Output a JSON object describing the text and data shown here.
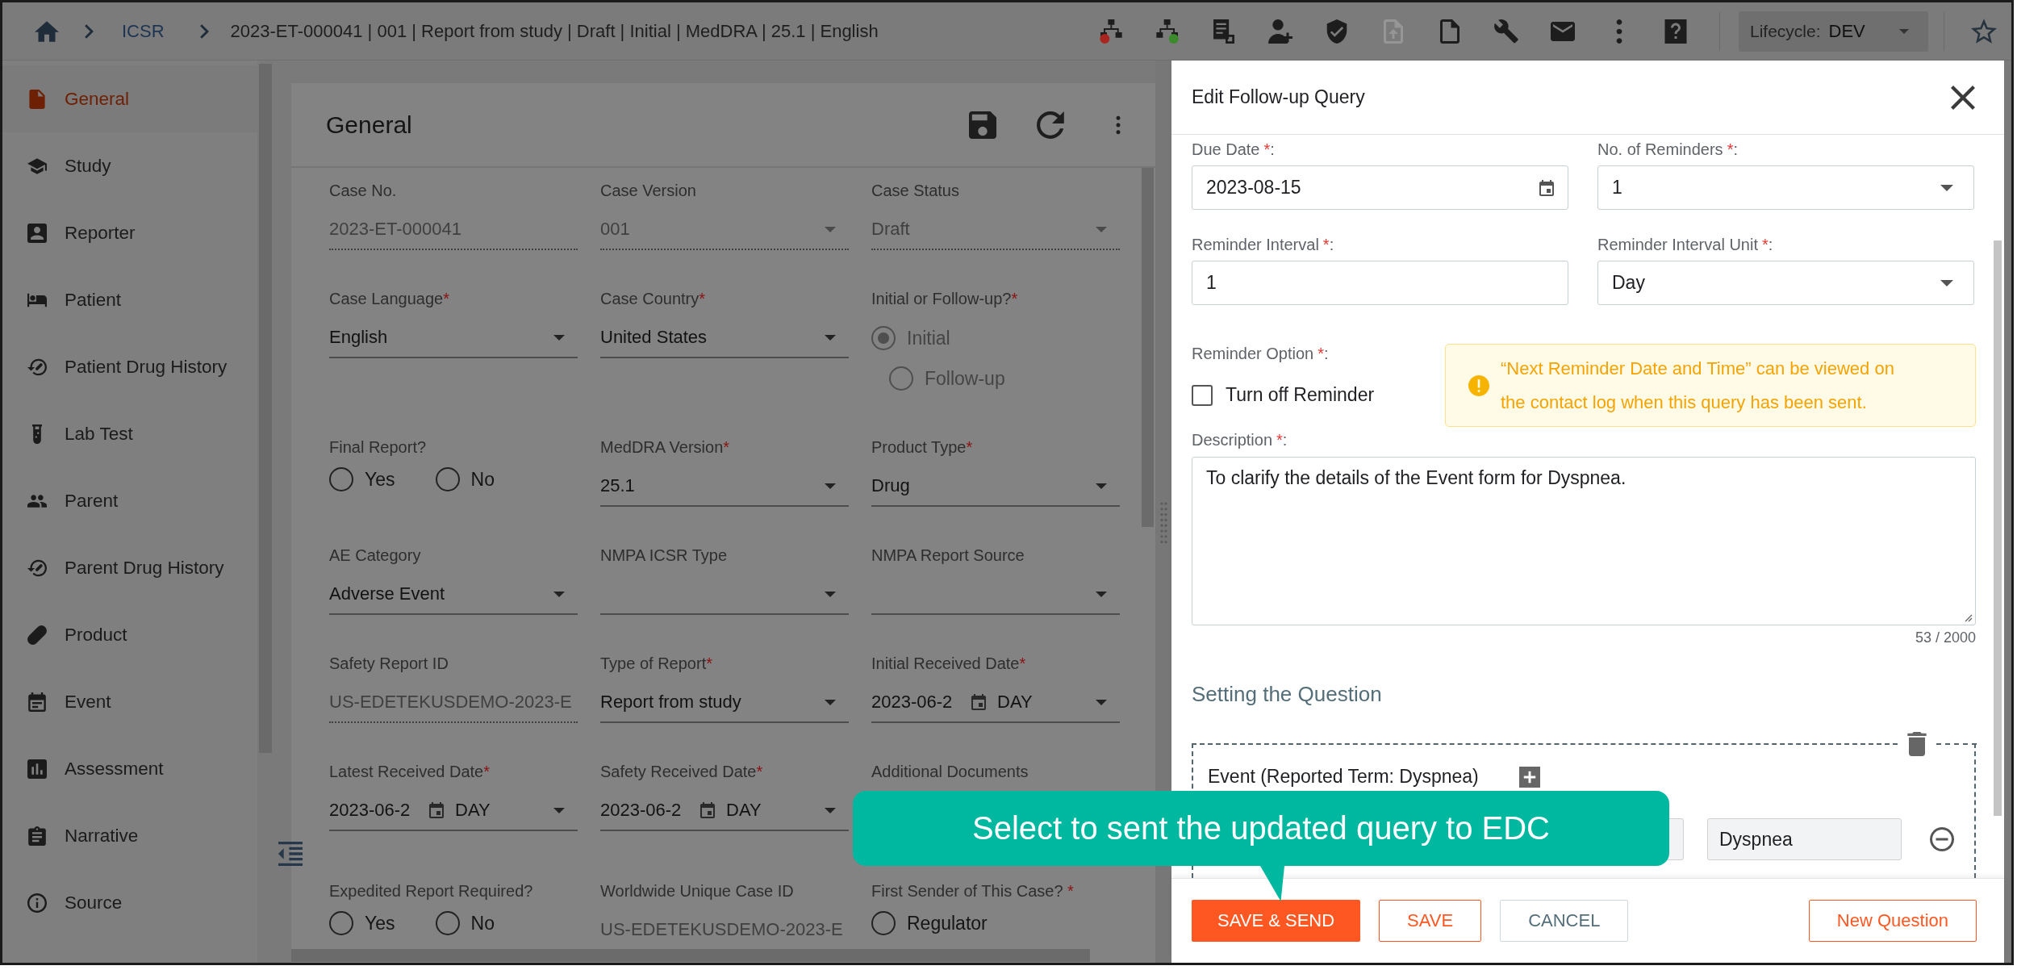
{
  "top_bar": {
    "breadcrumb": {
      "link": "ICSR",
      "current": "2023-ET-000041 | 001 | Report from study | Draft | Initial | MedDRA | 25.1 | English"
    },
    "toolbar": [
      {
        "kind": "unlink",
        "disabled": false
      },
      {
        "kind": "link",
        "disabled": false
      },
      {
        "kind": "report",
        "disabled": false
      },
      {
        "kind": "profile",
        "disabled": false
      },
      {
        "kind": "shield",
        "disabled": false
      },
      {
        "kind": "export",
        "disabled": true
      },
      {
        "kind": "file",
        "disabled": false
      },
      {
        "kind": "wrench",
        "disabled": false
      },
      {
        "kind": "mail",
        "disabled": false
      },
      {
        "kind": "more",
        "disabled": false
      },
      {
        "kind": "help",
        "disabled": false
      }
    ],
    "lifecycle": {
      "label": "Lifecycle:",
      "value": "DEV"
    }
  },
  "sidebar": {
    "items": [
      {
        "label": "General",
        "kind": "document",
        "selected": true
      },
      {
        "label": "Study",
        "kind": "school",
        "selected": false
      },
      {
        "label": "Reporter",
        "kind": "contact",
        "selected": false
      },
      {
        "label": "Patient",
        "kind": "bed",
        "selected": false
      },
      {
        "label": "Patient Drug History",
        "kind": "history",
        "selected": false
      },
      {
        "label": "Lab Test",
        "kind": "flask",
        "selected": false
      },
      {
        "label": "Parent",
        "kind": "people",
        "selected": false
      },
      {
        "label": "Parent Drug History",
        "kind": "history",
        "selected": false
      },
      {
        "label": "Product",
        "kind": "pill",
        "selected": false
      },
      {
        "label": "Event",
        "kind": "calendar",
        "selected": false
      },
      {
        "label": "Assessment",
        "kind": "chart",
        "selected": false
      },
      {
        "label": "Narrative",
        "kind": "clipboard",
        "selected": false
      },
      {
        "label": "Source",
        "kind": "info",
        "selected": false
      }
    ]
  },
  "general": {
    "title": "General",
    "fields": [
      {
        "kind": "text",
        "label": "Case No.",
        "value": "2023-ET-000041",
        "disabled": true
      },
      {
        "kind": "select",
        "label": "Case Version",
        "value": "001",
        "disabled": true
      },
      {
        "kind": "select",
        "label": "Case Status",
        "value": "Draft",
        "disabled": true
      },
      {
        "kind": "select",
        "label": "Case Language",
        "mark": "*",
        "value": "English",
        "disabled": false
      },
      {
        "kind": "select",
        "label": "Case Country",
        "mark": "*",
        "value": "United States",
        "disabled": false
      },
      {
        "kind": "radio_stack",
        "label": "Initial or Follow-up?",
        "mark": "*",
        "disabled": true,
        "options": [
          {
            "label": "Initial",
            "selected": true
          },
          {
            "label": "Follow-up",
            "selected": false
          }
        ]
      },
      {
        "kind": "radio",
        "label": "Final Report?",
        "disabled": false,
        "options": [
          {
            "label": "Yes",
            "selected": false
          },
          {
            "label": "No",
            "selected": false
          }
        ]
      },
      {
        "kind": "select",
        "label": "MedDRA Version",
        "mark": "*",
        "value": "25.1",
        "disabled": false
      },
      {
        "kind": "select",
        "label": "Product Type",
        "mark": "*",
        "value": "Drug",
        "disabled": false
      },
      {
        "kind": "select",
        "label": "AE Category",
        "value": "Adverse Event",
        "disabled": false
      },
      {
        "kind": "select",
        "label": "NMPA ICSR Type",
        "disabled": false
      },
      {
        "kind": "select",
        "label": "NMPA Report Source",
        "disabled": false
      },
      {
        "kind": "text",
        "label": "Safety Report ID",
        "value": "US-EDETEKUSDEMO-2023-E",
        "disabled": true
      },
      {
        "kind": "select",
        "label": "Type of Report",
        "mark": "*",
        "value": "Report from study",
        "disabled": false
      },
      {
        "kind": "date",
        "label": "Initial Received Date",
        "mark": "*",
        "value": "2023-06-2",
        "unit": "DAY",
        "disabled": false
      },
      {
        "kind": "date",
        "label": "Latest Received Date",
        "mark": "*",
        "value": "2023-06-2",
        "unit": "DAY",
        "disabled": false
      },
      {
        "kind": "date",
        "label": "Safety Received Date",
        "mark": "*",
        "value": "2023-06-2",
        "unit": "DAY",
        "disabled": false
      },
      {
        "kind": "documents",
        "label": "Additional Documents"
      },
      {
        "kind": "radio",
        "label": "Expedited Report Required?",
        "disabled": false,
        "options": [
          {
            "label": "Yes",
            "selected": false
          },
          {
            "label": "No",
            "selected": false
          }
        ]
      },
      {
        "kind": "text",
        "label": "Worldwide Unique Case ID",
        "value": "US-EDETEKUSDEMO-2023-E",
        "disabled": true
      },
      {
        "kind": "radio",
        "label": "First Sender of This Case?",
        "mark": " *",
        "disabled": false,
        "options": [
          {
            "label": "Regulator",
            "selected": false
          }
        ]
      }
    ]
  },
  "drawer": {
    "title": "Edit Follow-up Query",
    "fields": [
      {
        "kind": "date",
        "label": "Due Date",
        "mark": "*",
        "end": ":",
        "value": "2023-08-15"
      },
      {
        "kind": "select",
        "label": "No. of Reminders",
        "mark": "*",
        "end": ":",
        "value": "1"
      },
      {
        "kind": "text",
        "label": "Reminder Interval",
        "mark": "*",
        "end": ":",
        "value": "1"
      },
      {
        "kind": "select",
        "label": "Reminder Interval Unit",
        "mark": "*",
        "end": ":",
        "value": "Day"
      }
    ],
    "reminder_option": {
      "label": "Reminder Option",
      "mark": "*",
      "end": ":",
      "checkbox_label": "Turn off Reminder",
      "checked": false
    },
    "notice": "“Next Reminder Date and Time” can be viewed on the contact log when this query has been sent.",
    "description": {
      "label": "Description",
      "mark": "*",
      "end": ":",
      "value": "To clarify the details of the Event form for Dyspnea.",
      "counter": "53 / 2000"
    },
    "section_title": "Setting the Question",
    "question": {
      "label": "Event (Reported Term: Dyspnea)",
      "value": "Dyspnea"
    },
    "buttons": [
      {
        "label": "SAVE & SEND",
        "kind": "primary"
      },
      {
        "label": "SAVE",
        "kind": "outline"
      },
      {
        "label": "CANCEL",
        "kind": "neutral"
      },
      {
        "label": "New Question",
        "kind": "outline"
      }
    ]
  },
  "callout": {
    "text": "Select to sent the updated query to EDC"
  }
}
